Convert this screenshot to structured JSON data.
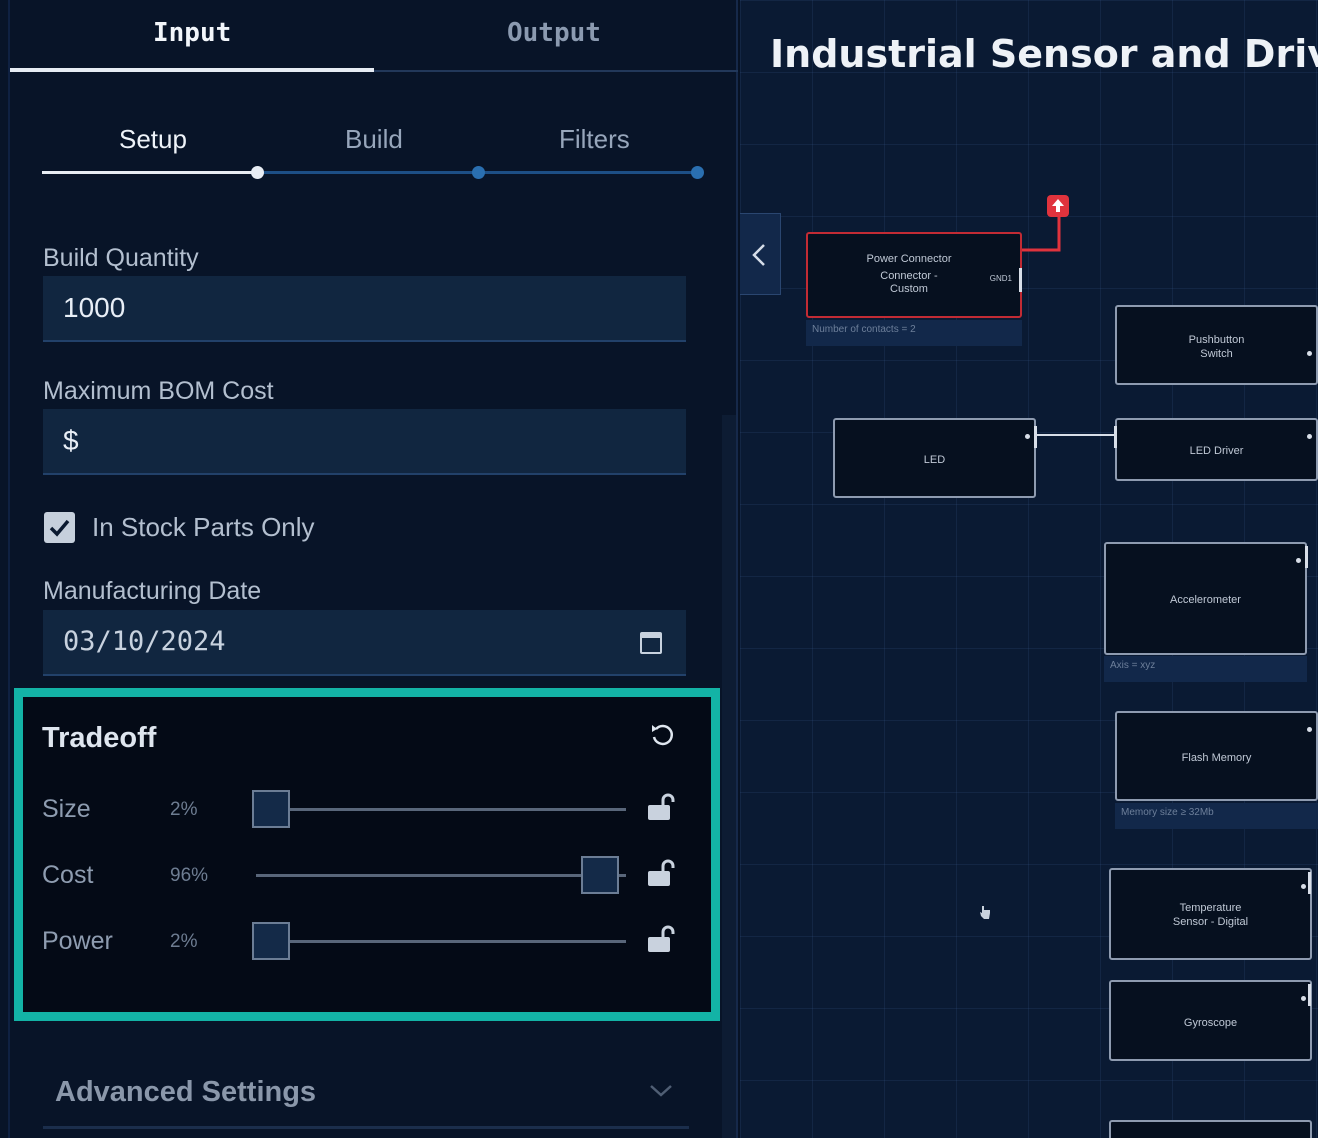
{
  "main_tabs": [
    {
      "label": "Input",
      "active": true
    },
    {
      "label": "Output",
      "active": false
    }
  ],
  "sub_tabs": [
    {
      "label": "Setup",
      "active": true
    },
    {
      "label": "Build",
      "active": false
    },
    {
      "label": "Filters",
      "active": false
    }
  ],
  "form": {
    "build_quantity": {
      "label": "Build Quantity",
      "value": "1000"
    },
    "max_bom_cost": {
      "label": "Maximum BOM Cost",
      "value": "$"
    },
    "in_stock": {
      "label": "In Stock Parts Only",
      "checked": true
    },
    "manufacturing_date": {
      "label": "Manufacturing Date",
      "value": "03/10/2024"
    }
  },
  "tradeoff": {
    "title": "Tradeoff",
    "sliders": [
      {
        "label": "Size",
        "value_text": "2%",
        "value": 2
      },
      {
        "label": "Cost",
        "value_text": "96%",
        "value": 96
      },
      {
        "label": "Power",
        "value_text": "2%",
        "value": 2
      }
    ]
  },
  "advanced": {
    "title": "Advanced Settings"
  },
  "canvas": {
    "title": "Industrial Sensor and Driver",
    "nodes": {
      "power": {
        "label_lines": [
          "Power Connector",
          "Connector -",
          "Custom"
        ],
        "port": "GND1",
        "note": "Number of contacts = 2"
      },
      "pushbutton": {
        "label_lines": [
          "Pushbutton",
          "Switch"
        ]
      },
      "led": {
        "label": "LED"
      },
      "led_driver": {
        "label": "LED Driver"
      },
      "accelerometer": {
        "label": "Accelerometer",
        "note": "Axis = xyz"
      },
      "flash": {
        "label": "Flash Memory",
        "note": "Memory size ≥ 32Mb"
      },
      "temperature": {
        "label_lines": [
          "Temperature",
          "Sensor - Digital"
        ]
      },
      "gyroscope": {
        "label": "Gyroscope"
      }
    }
  },
  "colors": {
    "highlight": "#13b3a6",
    "alert": "#e0333d",
    "accent": "#2a6fb0"
  }
}
